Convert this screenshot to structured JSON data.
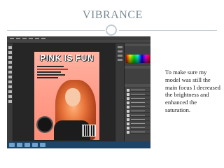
{
  "slide": {
    "title": "VIBRANCE",
    "caption": "To make sure my model was still the main focus I decreased the brightness and enhanced the saturation."
  },
  "photoshop": {
    "magazine_title": "PINK IS FUN"
  },
  "colors": {
    "title": "#7a8a96",
    "rule": "#c4ccd2",
    "ps_background": "#2e2e2e",
    "cover_pink": "#ff9f8c",
    "hair_orange": "#e8743a",
    "taskbar": "#1d4466"
  },
  "icons": [
    "title-ring-icon",
    "cd-disc-icon",
    "barcode-icon"
  ]
}
